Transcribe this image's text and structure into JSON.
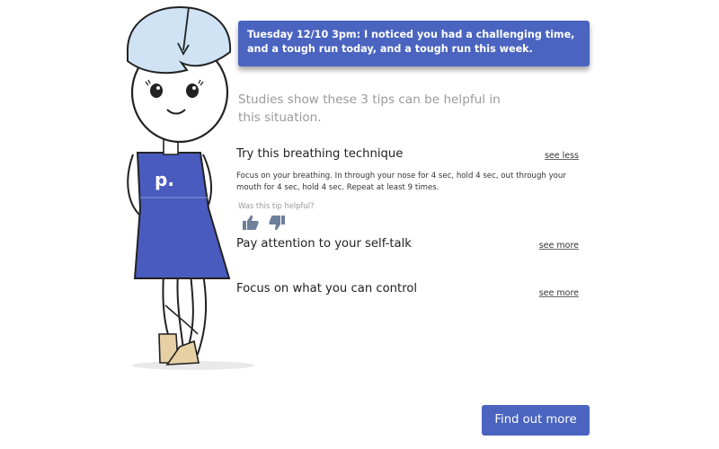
{
  "banner": {
    "text": "Tuesday 12/10 3pm:  I noticed you had a challenging time, and a tough run today, and a tough run this week."
  },
  "intro": {
    "text": "Studies show these 3 tips can be helpful in this situation."
  },
  "tips": [
    {
      "title": "Try this breathing technique",
      "toggle_label": "see less",
      "expanded": true,
      "body": "Focus on your breathing. In through your nose for 4 sec, hold 4 sec, out through your mouth for 4 sec, hold 4 sec. Repeat at least 9 times.",
      "feedback_question": "Was this tip helpful?"
    },
    {
      "title": "Pay attention to your self-talk",
      "toggle_label": "see more",
      "expanded": false
    },
    {
      "title": "Focus on what you can control",
      "toggle_label": "see more",
      "expanded": false
    }
  ],
  "character": {
    "shirt_logo": "p."
  },
  "cta": {
    "label": "Find out more"
  },
  "colors": {
    "accent": "#4a64c0",
    "thumb": "#6e7f9c",
    "muted_text": "#9a9a9a",
    "skin_shadow": "#e6e6e6"
  },
  "icons": {
    "thumbs_up": "thumbs-up-icon",
    "thumbs_down": "thumbs-down-icon"
  }
}
